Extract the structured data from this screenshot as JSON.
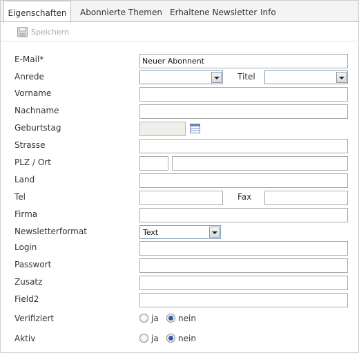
{
  "tabs": [
    {
      "label": "Eigenschaften",
      "active": true
    },
    {
      "label": "Abonnierte Themen",
      "active": false
    },
    {
      "label": "Erhaltene Newsletter",
      "active": false
    },
    {
      "label": "Info",
      "active": false
    }
  ],
  "toolbar": {
    "save_label": "Speichern",
    "save_icon": "floppy-disk-icon"
  },
  "form": {
    "email": {
      "label": "E-Mail*",
      "value": "Neuer Abonnent"
    },
    "anrede": {
      "label": "Anrede",
      "value": ""
    },
    "titel": {
      "label": "Titel",
      "value": ""
    },
    "vorname": {
      "label": "Vorname",
      "value": ""
    },
    "nachname": {
      "label": "Nachname",
      "value": ""
    },
    "geburtstag": {
      "label": "Geburtstag",
      "value": "",
      "icon": "calendar-icon"
    },
    "strasse": {
      "label": "Strasse",
      "value": ""
    },
    "plz_ort": {
      "label": "PLZ / Ort",
      "plz": "",
      "ort": ""
    },
    "land": {
      "label": "Land",
      "value": ""
    },
    "tel": {
      "label": "Tel",
      "value": ""
    },
    "fax": {
      "label": "Fax",
      "value": ""
    },
    "firma": {
      "label": "Firma",
      "value": ""
    },
    "newsletterformat": {
      "label": "Newsletterformat",
      "value": "Text"
    },
    "login": {
      "label": "Login",
      "value": ""
    },
    "passwort": {
      "label": "Passwort",
      "value": ""
    },
    "zusatz": {
      "label": "Zusatz",
      "value": ""
    },
    "field2": {
      "label": "Field2",
      "value": ""
    },
    "verifiziert": {
      "label": "Verifiziert",
      "options": [
        "ja",
        "nein"
      ],
      "selected": "nein"
    },
    "aktiv": {
      "label": "Aktiv",
      "options": [
        "ja",
        "nein"
      ],
      "selected": "nein"
    }
  },
  "colors": {
    "radio_checked": "#2a5aa5",
    "disabled_field": "#eeeeea",
    "border": "#a9a9a9"
  }
}
